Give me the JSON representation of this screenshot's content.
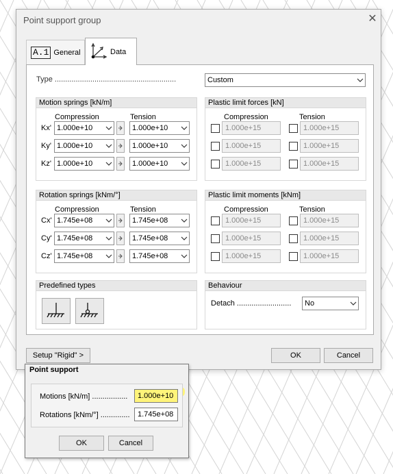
{
  "dialog": {
    "title": "Point support group",
    "close": "✕",
    "tabs": [
      {
        "label": "General",
        "icon_text": "A.1"
      },
      {
        "label": "Data"
      }
    ],
    "type_label": "Type ..........................................................",
    "type_value": "Custom",
    "motion_springs": {
      "title": "Motion springs [kN/m]",
      "compression_header": "Compression",
      "tension_header": "Tension",
      "rows": [
        {
          "label": "Kx'",
          "compression": "1.000e+10",
          "tension": "1.000e+10"
        },
        {
          "label": "Ky'",
          "compression": "1.000e+10",
          "tension": "1.000e+10"
        },
        {
          "label": "Kz'",
          "compression": "1.000e+10",
          "tension": "1.000e+10"
        }
      ]
    },
    "plastic_forces": {
      "title": "Plastic limit forces [kN]",
      "compression_header": "Compression",
      "tension_header": "Tension",
      "rows": [
        {
          "compression": "1.000e+15",
          "tension": "1.000e+15"
        },
        {
          "compression": "1.000e+15",
          "tension": "1.000e+15"
        },
        {
          "compression": "1.000e+15",
          "tension": "1.000e+15"
        }
      ]
    },
    "rotation_springs": {
      "title": "Rotation springs [kNm/°]",
      "compression_header": "Compression",
      "tension_header": "Tension",
      "rows": [
        {
          "label": "Cx'",
          "compression": "1.745e+08",
          "tension": "1.745e+08"
        },
        {
          "label": "Cy'",
          "compression": "1.745e+08",
          "tension": "1.745e+08"
        },
        {
          "label": "Cz'",
          "compression": "1.745e+08",
          "tension": "1.745e+08"
        }
      ]
    },
    "plastic_moments": {
      "title": "Plastic limit moments [kNm]",
      "compression_header": "Compression",
      "tension_header": "Tension",
      "rows": [
        {
          "compression": "1.000e+15",
          "tension": "1.000e+15"
        },
        {
          "compression": "1.000e+15",
          "tension": "1.000e+15"
        },
        {
          "compression": "1.000e+15",
          "tension": "1.000e+15"
        }
      ]
    },
    "predefined_title": "Predefined types",
    "behaviour": {
      "title": "Behaviour",
      "detach_label": "Detach ..........................",
      "detach_value": "No"
    },
    "setup_button": "Setup \"Rigid\" >",
    "ok_button": "OK",
    "cancel_button": "Cancel"
  },
  "point_support": {
    "title": "Point support",
    "motions_label": "Motions [kN/m] .................",
    "motions_value": "1.000e+10",
    "rotations_label": "Rotations [kNm/°] ..............",
    "rotations_value": "1.745e+08",
    "ok_button": "OK",
    "cancel_button": "Cancel",
    "highlight_color": "#fff47a"
  },
  "colors": {
    "dialog_bg": "#f0f0f0",
    "group_header_bg": "#e8e8e8",
    "disabled_text": "#8a8a8a"
  }
}
